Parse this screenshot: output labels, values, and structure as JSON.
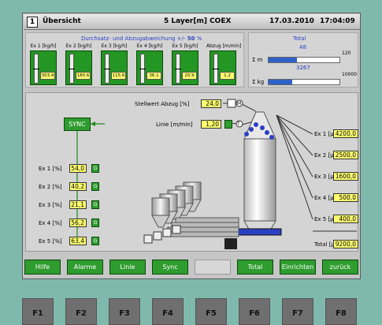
{
  "titlebar": {
    "icon": "1",
    "title": "Übersicht",
    "mode": "5 Layer[m] COEX",
    "date": "17.03.2010",
    "time": "17:04:09"
  },
  "deviation": {
    "heading": "Durchsatz- und Abzugabweichung +/-",
    "percent": "50",
    "unit": "%",
    "columns": [
      {
        "label": "Ex 1 [kg/h]",
        "value": "303.4"
      },
      {
        "label": "Ex 2 [kg/h]",
        "value": "180.6"
      },
      {
        "label": "Ex 3 [kg/h]",
        "value": "115.6"
      },
      {
        "label": "Ex 4 [kg/h]",
        "value": "36.1"
      },
      {
        "label": "Ex 5 [kg/h]",
        "value": "20.9"
      },
      {
        "label": "Abzug [m/min]",
        "value": "1.2"
      }
    ]
  },
  "total": {
    "title": "Total",
    "length_label": "Σ m",
    "length_value": "48",
    "length_max": "120",
    "length_fraction": 0.4,
    "mass_label": "Σ kg",
    "mass_value": "3267",
    "mass_max": "10000",
    "mass_fraction": 0.33
  },
  "diagram": {
    "stellwert_label": "Stellwert Abzug [%]",
    "stellwert_value": "24,0",
    "linie_label": "Linie [m/min]",
    "linie_value": "1,20",
    "sync_label": "SYNC",
    "extruders": [
      {
        "label": "Ex 1 [%]",
        "value": "54,0",
        "g": "G"
      },
      {
        "label": "Ex 2 [%]",
        "value": "40,2",
        "g": "G"
      },
      {
        "label": "Ex 3 [%]",
        "value": "21,1",
        "g": "G"
      },
      {
        "label": "Ex 4 [%]",
        "value": "56,2",
        "g": "G"
      },
      {
        "label": "Ex 5 [%]",
        "value": "63,4",
        "g": "G"
      }
    ],
    "layers": [
      {
        "label": "Ex 1 [µm]",
        "value": "4200,0"
      },
      {
        "label": "Ex 2 [µm]",
        "value": "2500,0"
      },
      {
        "label": "Ex 3 [µm]",
        "value": "1600,0"
      },
      {
        "label": "Ex 4 [µm]",
        "value": "500,0"
      },
      {
        "label": "Ex 5 [µm]",
        "value": "400,0"
      }
    ],
    "total_label": "Total [µm]",
    "total_value": "9200,0",
    "t_symbol": "T",
    "m_symbol": "M"
  },
  "buttons": [
    "Hilfe",
    "Alarme",
    "Linie",
    "Sync",
    "",
    "Total",
    "Einrichten",
    "zurück"
  ],
  "fkeys": [
    "F1",
    "F2",
    "F3",
    "F4",
    "F5",
    "F6",
    "F7",
    "F8"
  ],
  "colors": {
    "green": "#2f9c2f",
    "yellow": "#ffff70",
    "blue": "#2f62c8",
    "panel": "#d4d4d4",
    "bezel": "#7fb9ac"
  }
}
